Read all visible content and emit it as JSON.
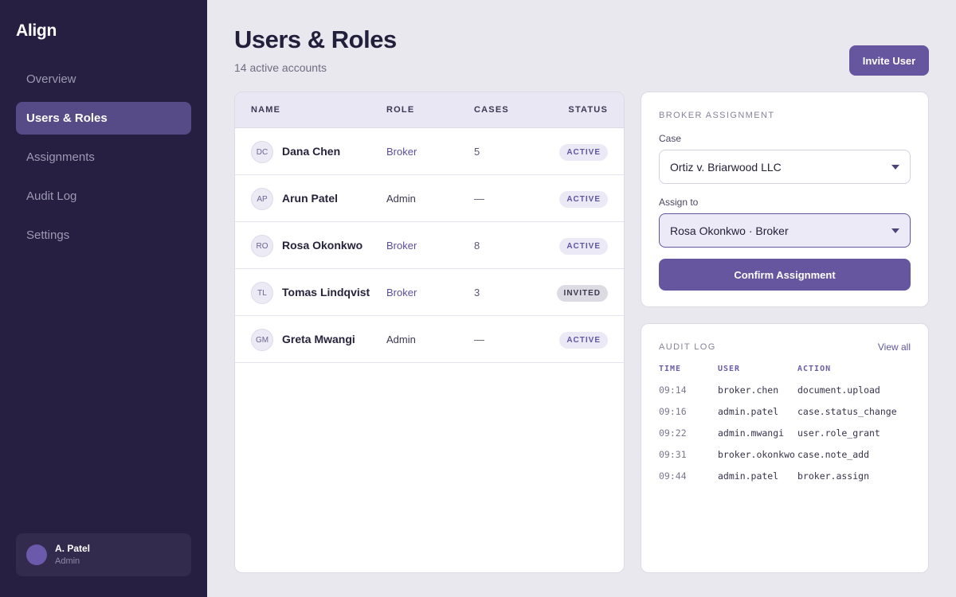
{
  "app": {
    "name": "Align"
  },
  "sidebar": {
    "items": [
      {
        "label": "Overview",
        "active": false
      },
      {
        "label": "Users & Roles",
        "active": true
      },
      {
        "label": "Assignments",
        "active": false
      },
      {
        "label": "Audit Log",
        "active": false
      },
      {
        "label": "Settings",
        "active": false
      }
    ],
    "user": {
      "name": "A. Patel",
      "role": "Admin"
    }
  },
  "header": {
    "title": "Users & Roles",
    "subtitle": "14 active accounts",
    "invite_label": "Invite User"
  },
  "users_table": {
    "columns": [
      "NAME",
      "ROLE",
      "CASES",
      "STATUS"
    ],
    "rows": [
      {
        "initials": "DC",
        "name": "Dana Chen",
        "role": "Broker",
        "cases": "5",
        "status": "ACTIVE"
      },
      {
        "initials": "AP",
        "name": "Arun Patel",
        "role": "Admin",
        "cases": "—",
        "status": "ACTIVE"
      },
      {
        "initials": "RO",
        "name": "Rosa Okonkwo",
        "role": "Broker",
        "cases": "8",
        "status": "ACTIVE"
      },
      {
        "initials": "TL",
        "name": "Tomas Lindqvist",
        "role": "Broker",
        "cases": "3",
        "status": "INVITED"
      },
      {
        "initials": "GM",
        "name": "Greta Mwangi",
        "role": "Admin",
        "cases": "—",
        "status": "ACTIVE"
      }
    ]
  },
  "broker_assignment": {
    "section_label": "BROKER ASSIGNMENT",
    "case_label": "Case",
    "case_value": "Ortiz v. Briarwood LLC",
    "assign_label": "Assign to",
    "assign_value": "Rosa Okonkwo · Broker",
    "confirm_label": "Confirm Assignment"
  },
  "audit_log": {
    "section_label": "AUDIT LOG",
    "view_all_label": "View all",
    "columns": [
      "TIME",
      "USER",
      "ACTION"
    ],
    "rows": [
      {
        "time": "09:14",
        "user": "broker.chen",
        "action": "document.upload"
      },
      {
        "time": "09:16",
        "user": "admin.patel",
        "action": "case.status_change"
      },
      {
        "time": "09:22",
        "user": "admin.mwangi",
        "action": "user.role_grant"
      },
      {
        "time": "09:31",
        "user": "broker.okonkwo",
        "action": "case.note_add"
      },
      {
        "time": "09:44",
        "user": "admin.patel",
        "action": "broker.assign"
      }
    ]
  },
  "colors": {
    "sidebar_bg": "#261f41",
    "accent": "#65569f",
    "broker_role": "#5a4f99",
    "badge_active_bg": "#ebe9f6",
    "badge_invited_bg": "#dcdbe3"
  }
}
